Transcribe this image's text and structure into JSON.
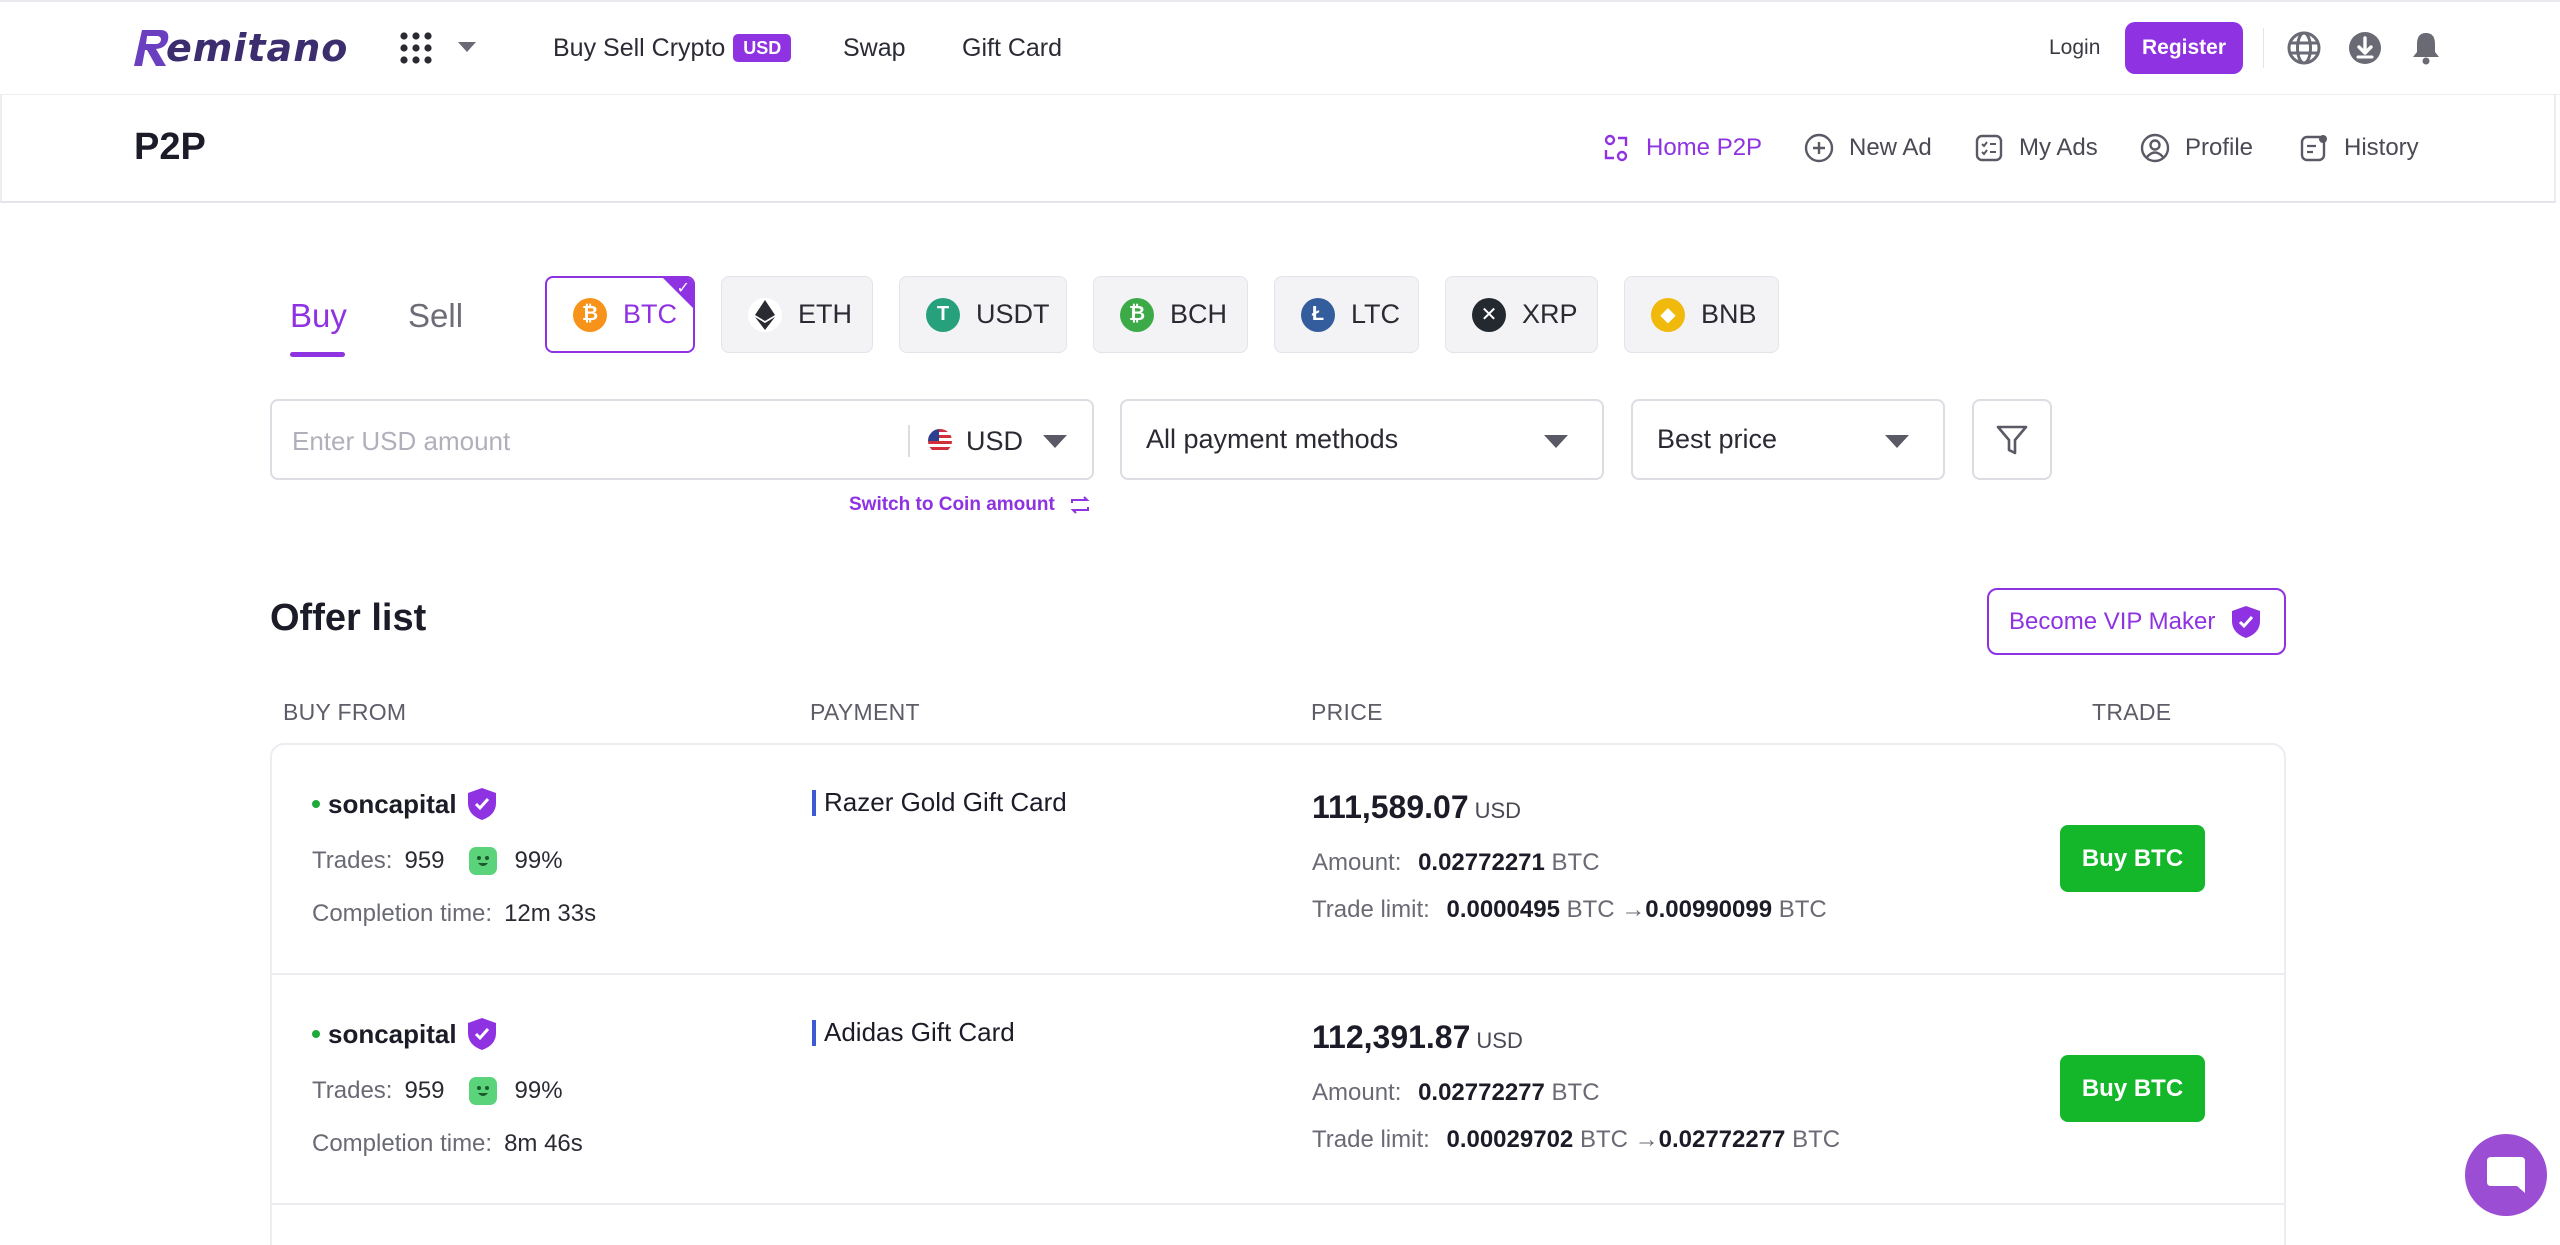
{
  "header": {
    "logo_text": "emitano",
    "nav": {
      "buy_sell": "Buy Sell Crypto",
      "buy_sell_badge": "USD",
      "swap": "Swap",
      "gift_card": "Gift Card"
    },
    "login": "Login",
    "register": "Register"
  },
  "subheader": {
    "title": "P2P",
    "links": {
      "home": "Home P2P",
      "new_ad": "New Ad",
      "my_ads": "My Ads",
      "profile": "Profile",
      "history": "History"
    }
  },
  "tabs": {
    "buy": "Buy",
    "sell": "Sell",
    "active": "Buy"
  },
  "coins": {
    "btc": "BTC",
    "eth": "ETH",
    "usdt": "USDT",
    "bch": "BCH",
    "ltc": "LTC",
    "xrp": "XRP",
    "bnb": "BNB",
    "selected": "BTC"
  },
  "filters": {
    "amount_placeholder": "Enter USD amount",
    "currency": "USD",
    "switch_label": "Switch to Coin amount",
    "payment_method": "All payment methods",
    "sort": "Best price"
  },
  "offers": {
    "title": "Offer list",
    "vip_button": "Become VIP Maker",
    "columns": {
      "from": "BUY FROM",
      "payment": "PAYMENT",
      "price": "PRICE",
      "trade": "TRADE"
    },
    "labels": {
      "trades": "Trades:",
      "completion": "Completion time:",
      "amount": "Amount:",
      "trade_limit": "Trade limit:",
      "arrow": "→"
    },
    "items": [
      {
        "seller": "soncapital",
        "trades": "959",
        "rating": "99%",
        "completion_time": "12m 33s",
        "payment": "Razer Gold Gift Card",
        "price": "111,589.07",
        "price_unit": "USD",
        "amount": "0.02772271",
        "amount_unit": "BTC",
        "limit_min": "0.0000495",
        "limit_max": "0.00990099",
        "limit_unit": "BTC",
        "action": "Buy BTC"
      },
      {
        "seller": "soncapital",
        "trades": "959",
        "rating": "99%",
        "completion_time": "8m 46s",
        "payment": "Adidas Gift Card",
        "price": "112,391.87",
        "price_unit": "USD",
        "amount": "0.02772277",
        "amount_unit": "BTC",
        "limit_min": "0.00029702",
        "limit_max": "0.02772277",
        "limit_unit": "BTC",
        "action": "Buy BTC"
      }
    ]
  },
  "colors": {
    "accent": "#8e32e2",
    "buy_green": "#14b62a",
    "btc": "#f7931a",
    "usdt": "#26a17b",
    "bch": "#3cab47",
    "ltc": "#345d9d",
    "bnb": "#f0b90b"
  },
  "icons": {
    "apps": "grid-icon",
    "language": "globe-icon",
    "download": "download-icon",
    "notifications": "bell-icon",
    "filter": "funnel-icon",
    "chat": "chat-icon"
  }
}
